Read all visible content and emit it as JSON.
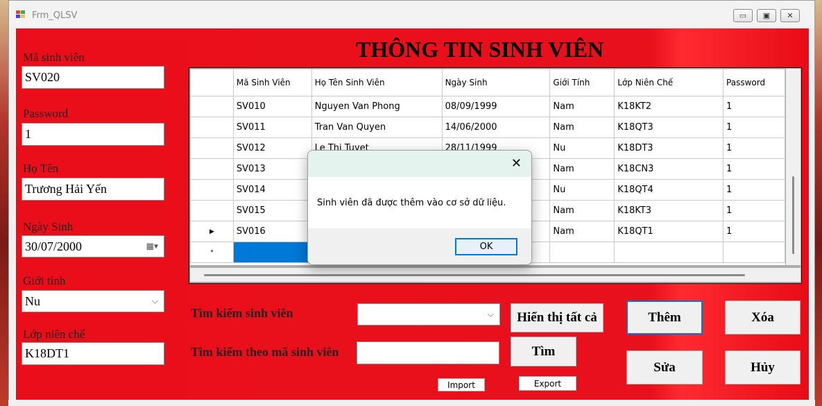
{
  "window": {
    "title": "Frm_QLSV",
    "min_glyph": "▭",
    "max_glyph": "▣",
    "close_glyph": "✕"
  },
  "form": {
    "heading": "THÔNG TIN SINH VIÊN",
    "ma_sv_label": "Mã sinh viên",
    "ma_sv_value": "SV020",
    "password_label": "Password",
    "password_value": "1",
    "ho_ten_label": "Họ Tên",
    "ho_ten_value": "Trương Hải Yến",
    "ngay_sinh_label": "Ngày Sinh",
    "ngay_sinh_value": "30/07/2000",
    "gioi_tinh_label": "Giới tính",
    "gioi_tinh_value": "Nu",
    "lop_label": "Lớp niên chế",
    "lop_value": "K18DT1"
  },
  "grid": {
    "columns": [
      "Mã Sinh Viên",
      "Họ Tên Sinh Viên",
      "Ngày Sinh",
      "Giới Tính",
      "Lớp Niên Chế",
      "Password"
    ],
    "rows": [
      [
        "SV010",
        "Nguyen Van Phong",
        "08/09/1999",
        "Nam",
        "K18KT2",
        "1"
      ],
      [
        "SV011",
        "Tran Van Quyen",
        "14/06/2000",
        "Nam",
        "K18QT3",
        "1"
      ],
      [
        "SV012",
        "Le Thi Tuyet",
        "28/11/1999",
        "Nu",
        "K18DT3",
        "1"
      ],
      [
        "SV013",
        "",
        "",
        "Nam",
        "K18CN3",
        "1"
      ],
      [
        "SV014",
        "",
        "",
        "Nu",
        "K18QT4",
        "1"
      ],
      [
        "SV015",
        "",
        "",
        "Nam",
        "K18KT3",
        "1"
      ],
      [
        "SV016",
        "",
        "",
        "Nam",
        "K18QT1",
        "1"
      ]
    ],
    "current_row_marker": "▶",
    "new_row_marker": "*",
    "selection_color": "#0078d7"
  },
  "search": {
    "label": "Tìm kiếm sinh viên",
    "by_id_label": "Tìm kiếm theo mã sinh viên",
    "show_all": "Hiển thị tất cả",
    "find": "Tìm",
    "import": "Import",
    "export": "Export"
  },
  "actions": {
    "add": "Thêm",
    "delete": "Xóa",
    "edit": "Sửa",
    "cancel": "Hủy"
  },
  "dialog": {
    "close_glyph": "✕",
    "message": "Sinh viên đã được thêm vào cơ sở dữ liệu.",
    "ok": "OK"
  },
  "icons": {
    "calendar": "calendar-icon",
    "dropdown": "chevron-down-icon",
    "arrow_glyph": "⌵",
    "calendar_glyph": "▦▾"
  },
  "colors": {
    "form_bg": "#e8101c",
    "dialog_title_bg": "#e5f3ef",
    "accent": "#0078d7"
  }
}
